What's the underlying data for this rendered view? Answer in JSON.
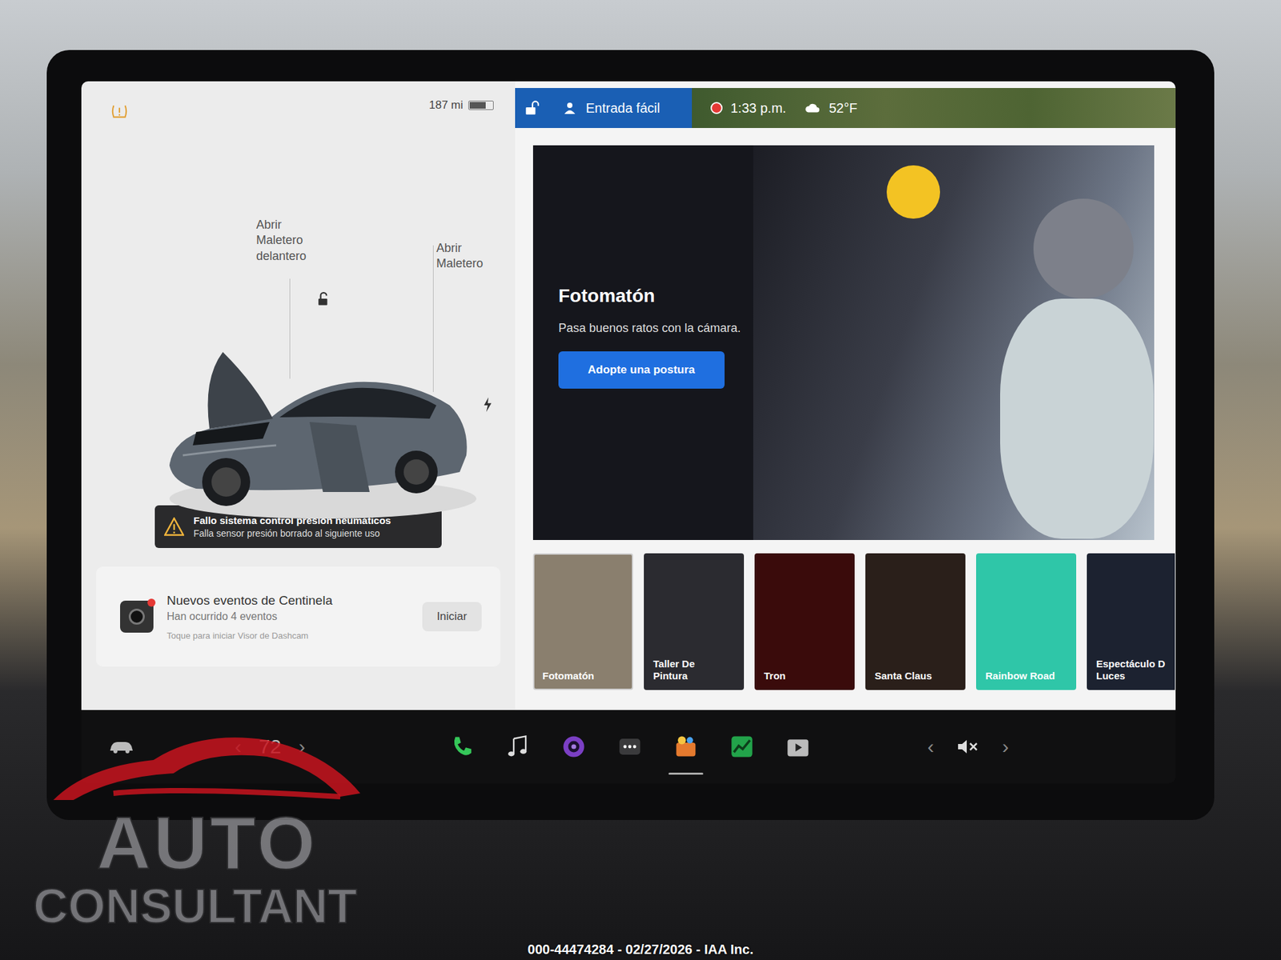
{
  "status_bar": {
    "range": "187 mi",
    "battery_level": 0.72,
    "locked": false,
    "profile": "Entrada fácil",
    "recording": true,
    "time": "1:33 p.m.",
    "temperature": "52°F"
  },
  "vehicle": {
    "frunk_label": "Abrir Maletero delantero",
    "trunk_label": "Abrir Maletero",
    "frunk_open": true,
    "door_open": true,
    "tire_warning": true
  },
  "alert": {
    "title": "Fallo sistema control presión neumáticos",
    "detail": "Falla sensor presión borrado al siguiente uso"
  },
  "sentinel": {
    "title": "Nuevos eventos de Centinela",
    "subtitle": "Han ocurrido 4 eventos",
    "hint": "Toque para iniciar Visor de Dashcam",
    "button": "Iniciar"
  },
  "featured": {
    "title": "Fotomatón",
    "subtitle": "Pasa buenos ratos con la cámara.",
    "button": "Adopte una postura"
  },
  "tiles": [
    {
      "lines": [
        "Fotomatón"
      ],
      "selected": true,
      "color": "#8a7f6e"
    },
    {
      "lines": [
        "Taller De",
        "Pintura"
      ],
      "selected": false,
      "color": "#2b2b30"
    },
    {
      "lines": [
        "Tron"
      ],
      "selected": false,
      "color": "#3a0b0b"
    },
    {
      "lines": [
        "Santa Claus"
      ],
      "selected": false,
      "color": "#2a1f1a"
    },
    {
      "lines": [
        "Rainbow Road"
      ],
      "selected": false,
      "color": "#2fc6a8"
    },
    {
      "lines": [
        "Espectáculo D",
        "Luces"
      ],
      "selected": false,
      "color": "#1c2230"
    }
  ],
  "dock": {
    "cabin_temperature": "72",
    "temp_down": "‹",
    "temp_up": "›",
    "volume_down": "‹",
    "volume_up": "›",
    "muted": true,
    "apps": [
      {
        "kind": "phone",
        "selected": false
      },
      {
        "kind": "music",
        "selected": false
      },
      {
        "kind": "camera",
        "selected": false
      },
      {
        "kind": "more",
        "selected": false
      },
      {
        "kind": "toybox",
        "selected": true
      },
      {
        "kind": "chart",
        "selected": false
      },
      {
        "kind": "video",
        "selected": false
      }
    ]
  },
  "watermark": {
    "line1": "AUTO",
    "line2": "CONSULTANT"
  },
  "caption": "000-44474284 - 02/27/2026 - IAA Inc."
}
